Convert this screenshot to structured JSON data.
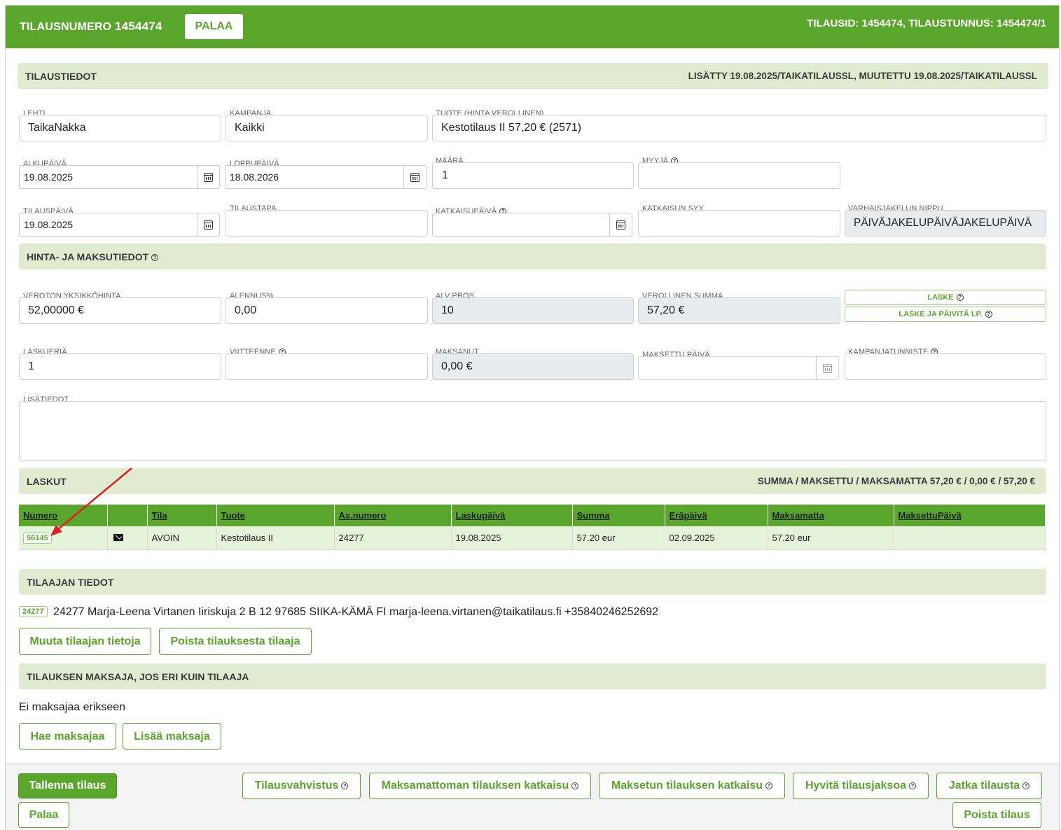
{
  "header": {
    "title_label": "TILAUSNUMERO",
    "order_number": "1454474",
    "back_button": "PALAA",
    "ids": "TILAUSID: 1454474, TILAUSTUNNUS: 1454474/1"
  },
  "order_info": {
    "title": "TILAUSTIEDOT",
    "meta": "LISÄTTY 19.08.2025/TAIKATILAUSSL, MUUTETTU 19.08.2025/TAIKATILAUSSL"
  },
  "fields": {
    "lehti": {
      "label": "LEHTI",
      "value": "TaikaNakka"
    },
    "kampanja": {
      "label": "KAMPANJA",
      "value": "Kaikki"
    },
    "tuote": {
      "label": "TUOTE (HINTA VEROLLINEN)",
      "value": "Kestotilaus II 57,20 € (2571)"
    },
    "alkupaiva": {
      "label": "ALKUPÄIVÄ",
      "value": "19.08.2025"
    },
    "loppupaiva": {
      "label": "LOPPUPÄIVÄ",
      "value": "18.08.2026"
    },
    "maara": {
      "label": "MÄÄRÄ",
      "value": "1"
    },
    "myyja": {
      "label": "MYYJÄ",
      "value": ""
    },
    "tilauspaiva": {
      "label": "TILAUSPÄIVÄ",
      "value": "19.08.2025"
    },
    "tilaustapa": {
      "label": "TILAUSTAPA",
      "value": ""
    },
    "katkaisupaiva": {
      "label": "KATKAISUPÄIVÄ",
      "value": ""
    },
    "katkaisun_syy": {
      "label": "KATKAISUN SYY",
      "value": ""
    },
    "varhaisjakelu": {
      "label": "VARHAISJAKELUN NIPPU",
      "value": "PÄIVÄJAKELUPÄIVÄJAKELUPÄIVÄ"
    }
  },
  "price": {
    "title": "HINTA- JA MAKSUTIEDOT",
    "veroton": {
      "label": "VEROTON YKSIKKÖHINTA",
      "value": "52,00000 €"
    },
    "alennus": {
      "label": "ALENNUS%",
      "value": "0,00"
    },
    "alv": {
      "label": "ALV PROS",
      "value": "10"
    },
    "verollinen": {
      "label": "VEROLLINEN SUMMA",
      "value": "57,20 €"
    },
    "laske_btn": "LASKE",
    "laske_paivita_btn": "LASKE JA PÄIVITÄ LP.",
    "laskuera": {
      "label": "LASKUERIÄ",
      "value": "1"
    },
    "viitteenne": {
      "label": "VIITTEENNE",
      "value": ""
    },
    "maksanut": {
      "label": "MAKSANUT",
      "value": "0,00 €"
    },
    "maksettu_paiva": {
      "label": "MAKSETTU PÄIVÄ",
      "value": ""
    },
    "kampanjatunniste": {
      "label": "KAMPANJATUNNISTE",
      "value": ""
    },
    "lisatiedot": {
      "label": "LISÄTIEDOT",
      "value": ""
    }
  },
  "invoices": {
    "title": "LASKUT",
    "summary": "SUMMA / MAKSETTU / MAKSAMATTA 57,20 € / 0,00 € / 57,20 €",
    "columns": [
      "Numero",
      "",
      "Tila",
      "Tuote",
      "As.numero",
      "Laskupäivä",
      "Summa",
      "Eräpäivä",
      "Maksamatta",
      "MaksettuPäivä"
    ],
    "rows": [
      {
        "numero": "56145",
        "tila": "AVOIN",
        "tuote": "Kestotilaus II",
        "as_numero": "24277",
        "laskupaiva": "19.08.2025",
        "summa": "57.20 eur",
        "erapaiva": "02.09.2025",
        "maksamatta": "57.20 eur",
        "maksettu_paiva": ""
      }
    ]
  },
  "subscriber": {
    "title": "TILAAJAN TIEDOT",
    "tag": "24277",
    "details": "24277 Marja-Leena Virtanen Iiriskuja 2 B 12 97685 SIIKA-KÄMÄ FI marja-leena.virtanen@taikatilaus.fi +35840246252692",
    "edit_button": "Muuta tilaajan tietoja",
    "remove_button": "Poista tilauksesta tilaaja"
  },
  "payer": {
    "title": "TILAUKSEN MAKSAJA, JOS ERI KUIN TILAAJA",
    "none_text": "Ei maksajaa erikseen",
    "fetch_button": "Hae maksajaa",
    "add_button": "Lisää maksaja"
  },
  "footer": {
    "save": "Tallenna tilaus",
    "confirm": "Tilausvahvistus",
    "cut_unpaid": "Maksamattoman tilauksen katkaisu",
    "cut_paid": "Maksetun tilauksen katkaisu",
    "credit": "Hyvitä tilausjaksoa",
    "continue": "Jatka tilausta",
    "back": "Palaa",
    "delete": "Poista tilaus"
  },
  "colors": {
    "accent": "#5aa62d",
    "section_bg": "#e0ebcf",
    "row_bg": "#e4f3da",
    "annotation_arrow": "#e02020"
  }
}
